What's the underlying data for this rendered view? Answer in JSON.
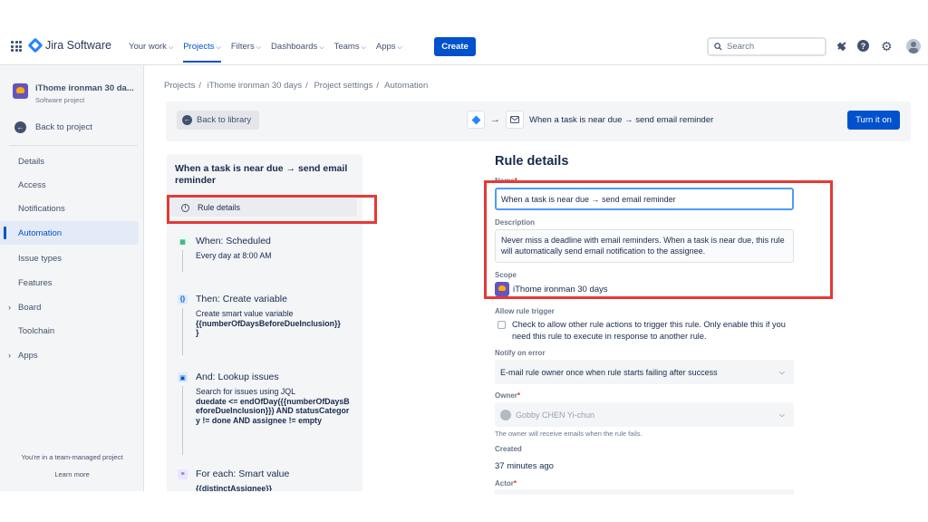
{
  "nav": {
    "product": "Jira Software",
    "items": [
      {
        "label": "Your work",
        "chevron": true,
        "active": false
      },
      {
        "label": "Projects",
        "chevron": true,
        "active": true
      },
      {
        "label": "Filters",
        "chevron": true,
        "active": false
      },
      {
        "label": "Dashboards",
        "chevron": true,
        "active": false
      },
      {
        "label": "Teams",
        "chevron": true,
        "active": false
      },
      {
        "label": "Apps",
        "chevron": true,
        "active": false
      }
    ],
    "create_label": "Create",
    "search_placeholder": "Search",
    "icons": [
      "app-switcher-icon",
      "notifications-icon",
      "help-icon",
      "settings-icon",
      "profile-avatar"
    ]
  },
  "sidebar": {
    "project_name": "iThome ironman 30 da...",
    "project_type": "Software project",
    "back_label": "Back to project",
    "items": [
      {
        "label": "Details",
        "active": false,
        "expandable": false
      },
      {
        "label": "Access",
        "active": false,
        "expandable": false
      },
      {
        "label": "Notifications",
        "active": false,
        "expandable": false
      },
      {
        "label": "Automation",
        "active": true,
        "expandable": false
      },
      {
        "label": "Issue types",
        "active": false,
        "expandable": false
      },
      {
        "label": "Features",
        "active": false,
        "expandable": false
      },
      {
        "label": "Board",
        "active": false,
        "expandable": true
      },
      {
        "label": "Toolchain",
        "active": false,
        "expandable": false
      },
      {
        "label": "Apps",
        "active": false,
        "expandable": true
      }
    ],
    "team_note": "You're in a team-managed project",
    "learn_more": "Learn more"
  },
  "breadcrumb": [
    "Projects",
    "iThome ironman 30 days",
    "Project settings",
    "Automation"
  ],
  "header": {
    "back_to_library": "Back to library",
    "flow_title": "When a task is near due → send email reminder",
    "turn_on_label": "Turn it on"
  },
  "rule": {
    "title": "When a task is near due → send email reminder",
    "rule_details_label": "Rule details",
    "steps": [
      {
        "icon": "calendar-icon",
        "color": "#36b37e",
        "heading": "When: Scheduled",
        "body": "Every day at 8:00 AM"
      },
      {
        "icon": "braces-icon",
        "color": "#0065ff",
        "heading": "Then: Create variable",
        "body_prefix": "Create smart value variable",
        "body_bold": "{{numberOfDaysBeforeDueInclusion}}"
      },
      {
        "icon": "lookup-icon",
        "color": "#0065ff",
        "heading": "And: Lookup issues",
        "body_prefix": "Search for issues using JQL",
        "body_bold": "duedate <= endOfDay({{numberOfDaysBeforeDueInclusion}}) AND statusCategory != done AND assignee != empty"
      },
      {
        "icon": "list-icon",
        "color": "#6554c0",
        "heading": "For each: Smart value",
        "body_bold": "{{distinctAssignee}}"
      }
    ]
  },
  "details": {
    "title": "Rule details",
    "name_label": "Name",
    "name_value": "When a task is near due → send email reminder",
    "description_label": "Description",
    "description_value": "Never miss a deadline with email reminders. When a task is near due, this rule will automatically send email notification to the assignee.",
    "scope_label": "Scope",
    "scope_value": "iThome ironman 30 days",
    "allow_trigger_label": "Allow rule trigger",
    "allow_trigger_text": "Check to allow other rule actions to trigger this rule. Only enable this if you need this rule to execute in response to another rule.",
    "allow_trigger_checked": false,
    "notify_label": "Notify on error",
    "notify_value": "E-mail rule owner once when rule starts failing after success",
    "owner_label": "Owner",
    "owner_value": "Gobby CHEN Yi-chun",
    "owner_hint": "The owner will receive emails when the rule fails.",
    "created_label": "Created",
    "created_value": "37 minutes ago",
    "actor_label": "Actor"
  },
  "colors": {
    "brand": "#0052cc",
    "highlight": "#e53935"
  }
}
